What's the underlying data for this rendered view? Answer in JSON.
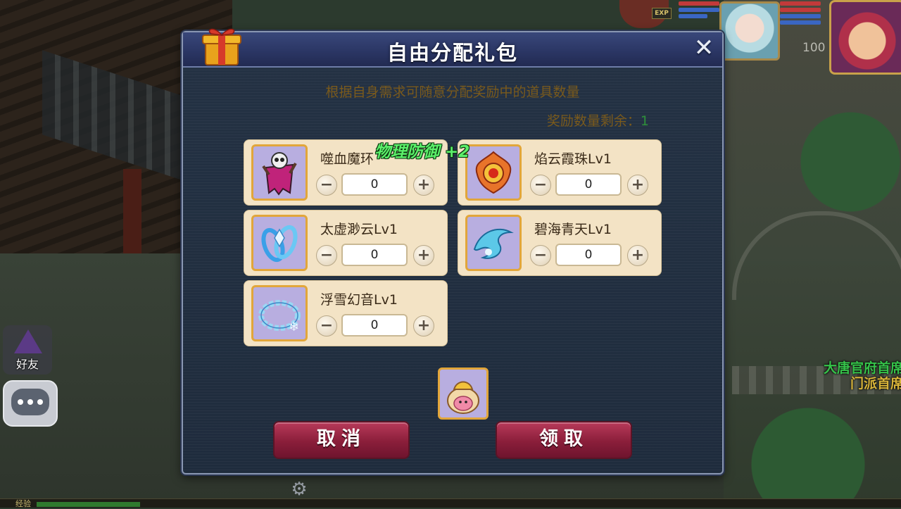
{
  "dialog": {
    "title": "自由分配礼包",
    "close_label": "✕",
    "subtitle": "根据自身需求可随意分配奖励中的道具数量",
    "remain_label": "奖励数量剩余：",
    "remain_value": "1",
    "items": [
      {
        "name": "噬血魔环",
        "qty": "0",
        "icon": "skull-ghost-icon"
      },
      {
        "name": "焰云霞珠Lv1",
        "qty": "0",
        "icon": "fire-orb-icon"
      },
      {
        "name": "太虚渺云Lv1",
        "qty": "0",
        "icon": "ice-ring-icon"
      },
      {
        "name": "碧海青天Lv1",
        "qty": "0",
        "icon": "water-wave-icon"
      },
      {
        "name": "浮雪幻音Lv1",
        "qty": "0",
        "icon": "snow-bracelet-icon"
      }
    ],
    "minus_label": "−",
    "plus_label": "+",
    "floating_text": "物理防御 +2",
    "cancel_label": "取消",
    "confirm_label": "领取"
  },
  "hud": {
    "exp_tag": "EXP",
    "pet_level": "100",
    "friend_label": "好友",
    "map_text_1": "大唐官府首席",
    "map_text_2": "门派首席",
    "exp_label": "经验",
    "exp_progress": 0.12
  },
  "colors": {
    "dialog_bg": "#1f2c3d",
    "card_bg": "#f3e3c5",
    "button": "#8a1e3a",
    "subtitle": "#7a5a1c",
    "remain_value": "#2e8f3a",
    "floating_text": "#5cf06a"
  }
}
